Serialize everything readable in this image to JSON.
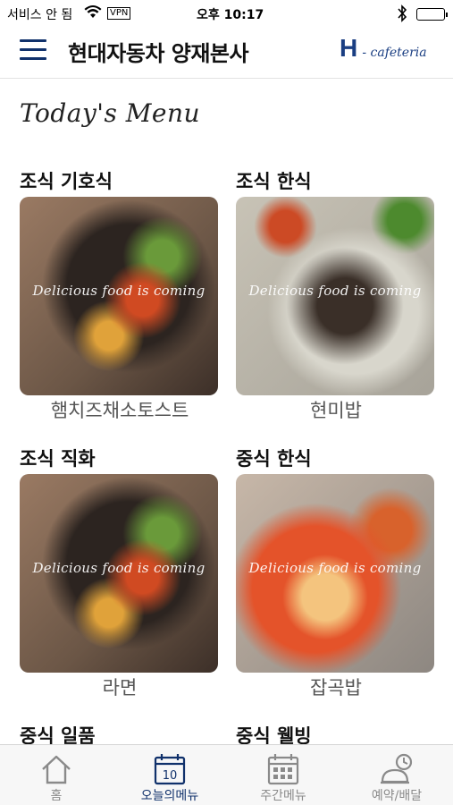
{
  "status_bar": {
    "carrier": "서비스 안 됨",
    "vpn": "VPN",
    "time": "오후 10:17"
  },
  "header": {
    "title": "현대자동차 양재본사",
    "logo_letter": "H",
    "logo_rest": "- cafeteria"
  },
  "section_title": "Today's Menu",
  "cards": [
    {
      "category": "조식 기호식",
      "overlay": "Delicious food is coming",
      "dish": "햄치즈채소토스트"
    },
    {
      "category": "조식 한식",
      "overlay": "Delicious food is coming",
      "dish": "현미밥"
    },
    {
      "category": "조식 직화",
      "overlay": "Delicious food is coming",
      "dish": "라면"
    },
    {
      "category": "중식 한식",
      "overlay": "Delicious food is coming",
      "dish": "잡곡밥"
    },
    {
      "category": "중식 일품",
      "overlay": "",
      "dish": ""
    },
    {
      "category": "중식 웰빙",
      "overlay": "",
      "dish": ""
    }
  ],
  "tabs": [
    {
      "label": "홈",
      "icon": "home-icon"
    },
    {
      "label": "오늘의메뉴",
      "icon": "calendar-today-icon",
      "calendar_day": "10",
      "active": true
    },
    {
      "label": "주간메뉴",
      "icon": "calendar-week-icon"
    },
    {
      "label": "예약/배달",
      "icon": "reservation-clock-icon"
    }
  ],
  "colors": {
    "accent": "#10316b",
    "inactive": "#8a8a8a"
  }
}
